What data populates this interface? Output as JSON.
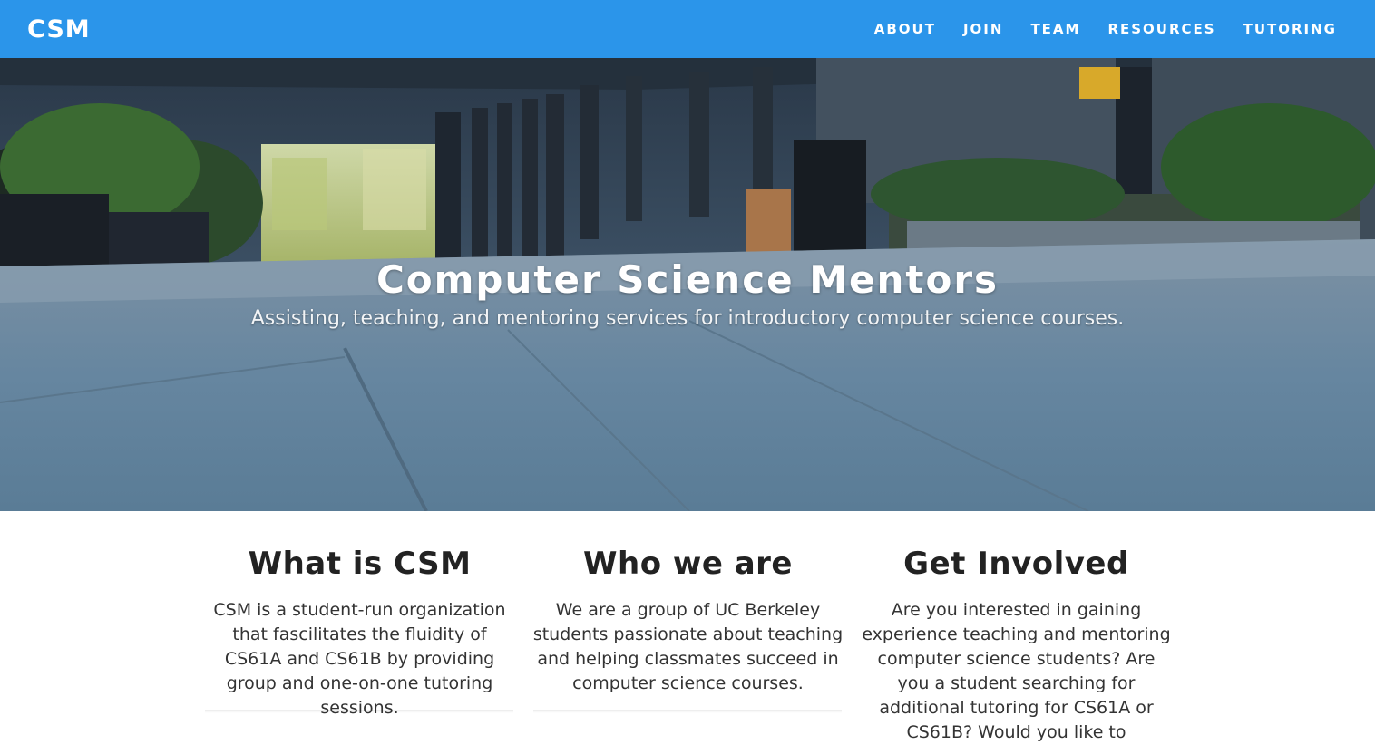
{
  "nav": {
    "brand": "CSM",
    "links": [
      "ABOUT",
      "JOIN",
      "TEAM",
      "RESOURCES",
      "TUTORING"
    ]
  },
  "hero": {
    "title": "Computer Science Mentors",
    "subtitle": "Assisting, teaching, and mentoring services for introductory computer science courses."
  },
  "features": [
    {
      "heading": "What is CSM",
      "body": "CSM is a student-run organization that fascilitates the fluidity of CS61A and CS61B by providing group and one-on-one tutoring sessions."
    },
    {
      "heading": "Who we are",
      "body": "We are a group of UC Berkeley students passionate about teaching and helping classmates succeed in computer science courses."
    },
    {
      "heading": "Get Involved",
      "body": "Are you interested in gaining experience teaching and mentoring computer science students? Are you a student searching for additional tutoring for CS61A or CS61B? Would you like to"
    }
  ],
  "colors": {
    "nav_bg": "#2b95ea",
    "heading": "#222222",
    "body_text": "#333333"
  }
}
